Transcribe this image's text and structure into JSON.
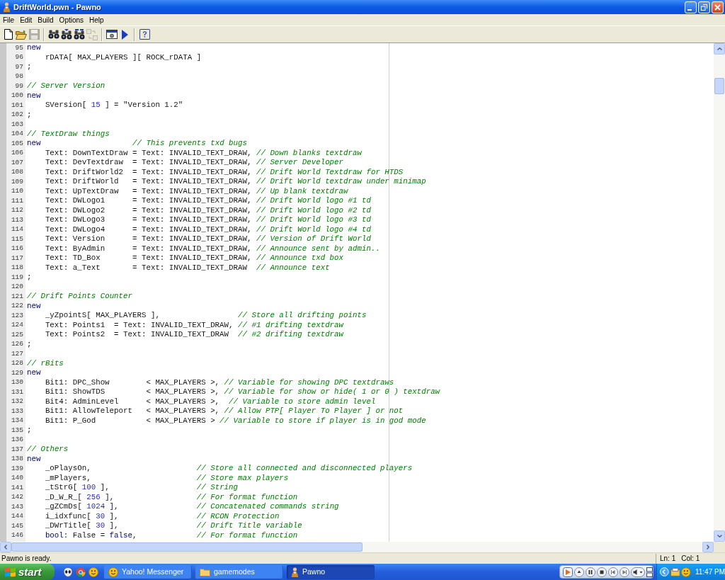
{
  "window": {
    "title": "DriftWorld.pwn - Pawno"
  },
  "menu": [
    "File",
    "Edit",
    "Build",
    "Options",
    "Help"
  ],
  "toolbar_groups": [
    [
      {
        "kind": "new",
        "disabled": false
      },
      {
        "kind": "open",
        "disabled": false
      },
      {
        "kind": "save",
        "disabled": true
      }
    ],
    [
      {
        "kind": "find",
        "disabled": false
      },
      {
        "kind": "find_next",
        "disabled": false
      },
      {
        "kind": "replace",
        "disabled": false
      },
      {
        "kind": "swap",
        "disabled": true
      }
    ],
    [
      {
        "kind": "compile",
        "disabled": false
      },
      {
        "kind": "run",
        "disabled": false
      }
    ],
    [
      {
        "kind": "help",
        "disabled": false
      }
    ]
  ],
  "editor": {
    "lines": [
      {
        "number": "95",
        "segments": [
          {
            "kind": "keyword",
            "text": "new"
          }
        ],
        "children": [
          {
            "number": "96",
            "segments": [
              {
                "kind": "plain",
                "text": "rDATA[ MAX_PLAYERS ][ ROCK_rDATA ]"
              }
            ]
          }
        ]
      },
      {
        "number": "97",
        "segments": [
          {
            "kind": "plain",
            "text": ";"
          }
        ]
      },
      {
        "number": "98"
      },
      {
        "number": "99",
        "segments": [
          {
            "kind": "comment",
            "text": "// Server Version"
          }
        ]
      },
      {
        "number": "100",
        "segments": [
          {
            "kind": "keyword",
            "text": "new"
          }
        ],
        "children": [
          {
            "number": "101",
            "segments": [
              {
                "kind": "plain",
                "text": "SVersion[ "
              },
              {
                "kind": "number",
                "text": "15"
              },
              {
                "kind": "plain",
                "text": " ] = \"Version 1.2\""
              }
            ]
          }
        ]
      },
      {
        "number": "102",
        "segments": [
          {
            "kind": "plain",
            "text": ";"
          }
        ]
      },
      {
        "number": "103"
      },
      {
        "number": "104",
        "segments": [
          {
            "kind": "comment",
            "text": "// TextDraw things"
          }
        ]
      },
      {
        "number": "105",
        "segments": [
          {
            "kind": "keyword",
            "text": "new"
          },
          {
            "kind": "comment",
            "text": "                    // This prevents txd bugs"
          }
        ],
        "children": [
          {
            "number": "106",
            "segments": [
              {
                "kind": "plain",
                "text": "Text: DownTextDraw = Text: INVALID_TEXT_DRAW, "
              },
              {
                "kind": "comment",
                "text": "// Down blanks textdraw"
              }
            ]
          },
          {
            "number": "107",
            "segments": [
              {
                "kind": "plain",
                "text": "Text: DevTextdraw  = Text: INVALID_TEXT_DRAW, "
              },
              {
                "kind": "comment",
                "text": "// Server Developer"
              }
            ]
          },
          {
            "number": "108",
            "segments": [
              {
                "kind": "plain",
                "text": "Text: DriftWorld2  = Text: INVALID_TEXT_DRAW, "
              },
              {
                "kind": "comment",
                "text": "// Drift World Textdraw for HTDS"
              }
            ]
          },
          {
            "number": "109",
            "segments": [
              {
                "kind": "plain",
                "text": "Text: DriftWorld   = Text: INVALID_TEXT_DRAW, "
              },
              {
                "kind": "comment",
                "text": "// Drift World textdraw under minimap"
              }
            ]
          },
          {
            "number": "110",
            "segments": [
              {
                "kind": "plain",
                "text": "Text: UpTextDraw   = Text: INVALID_TEXT_DRAW, "
              },
              {
                "kind": "comment",
                "text": "// Up blank textdraw"
              }
            ]
          },
          {
            "number": "111",
            "segments": [
              {
                "kind": "plain",
                "text": "Text: DWLogo1      = Text: INVALID_TEXT_DRAW, "
              },
              {
                "kind": "comment",
                "text": "// Drift World logo #1 td"
              }
            ]
          },
          {
            "number": "112",
            "segments": [
              {
                "kind": "plain",
                "text": "Text: DWLogo2      = Text: INVALID_TEXT_DRAW, "
              },
              {
                "kind": "comment",
                "text": "// Drift World logo #2 td"
              }
            ]
          },
          {
            "number": "113",
            "segments": [
              {
                "kind": "plain",
                "text": "Text: DWLogo3      = Text: INVALID_TEXT_DRAW, "
              },
              {
                "kind": "comment",
                "text": "// Drift World logo #3 td"
              }
            ]
          },
          {
            "number": "114",
            "segments": [
              {
                "kind": "plain",
                "text": "Text: DWLogo4      = Text: INVALID_TEXT_DRAW, "
              },
              {
                "kind": "comment",
                "text": "// Drift World logo #4 td"
              }
            ]
          },
          {
            "number": "115",
            "segments": [
              {
                "kind": "plain",
                "text": "Text: Version      = Text: INVALID_TEXT_DRAW, "
              },
              {
                "kind": "comment",
                "text": "// Version of Drift World"
              }
            ]
          },
          {
            "number": "116",
            "segments": [
              {
                "kind": "plain",
                "text": "Text: ByAdmin      = Text: INVALID_TEXT_DRAW, "
              },
              {
                "kind": "comment",
                "text": "// Announce sent by admin.."
              }
            ]
          },
          {
            "number": "117",
            "segments": [
              {
                "kind": "plain",
                "text": "Text: TD_Box       = Text: INVALID_TEXT_DRAW, "
              },
              {
                "kind": "comment",
                "text": "// Announce txd box"
              }
            ]
          },
          {
            "number": "118",
            "segments": [
              {
                "kind": "plain",
                "text": "Text: a_Text       = Text: INVALID_TEXT_DRAW  "
              },
              {
                "kind": "comment",
                "text": "// Announce text"
              }
            ]
          }
        ]
      },
      {
        "number": "119",
        "segments": [
          {
            "kind": "plain",
            "text": ";"
          }
        ]
      },
      {
        "number": "120"
      },
      {
        "number": "121",
        "segments": [
          {
            "kind": "comment",
            "text": "// Drift Points Counter"
          }
        ]
      },
      {
        "number": "122",
        "segments": [
          {
            "kind": "keyword",
            "text": "new"
          }
        ],
        "children": [
          {
            "number": "123",
            "segments": [
              {
                "kind": "plain",
                "text": "_yZpointS[ MAX_PLAYERS ],                 "
              },
              {
                "kind": "comment",
                "text": "// Store all drifting points"
              }
            ]
          },
          {
            "number": "124",
            "segments": [
              {
                "kind": "plain",
                "text": "Text: Points1  = Text: INVALID_TEXT_DRAW, "
              },
              {
                "kind": "comment",
                "text": "// #1 drifting textdraw"
              }
            ]
          },
          {
            "number": "125",
            "segments": [
              {
                "kind": "plain",
                "text": "Text: Points2  = Text: INVALID_TEXT_DRAW  "
              },
              {
                "kind": "comment",
                "text": "// #2 drifting textdraw"
              }
            ]
          }
        ]
      },
      {
        "number": "126",
        "segments": [
          {
            "kind": "plain",
            "text": ";"
          }
        ]
      },
      {
        "number": "127"
      },
      {
        "number": "128",
        "segments": [
          {
            "kind": "comment",
            "text": "// rBits"
          }
        ]
      },
      {
        "number": "129",
        "segments": [
          {
            "kind": "keyword",
            "text": "new"
          }
        ],
        "children": [
          {
            "number": "130",
            "segments": [
              {
                "kind": "plain",
                "text": "Bit1: DPC_Show        < MAX_PLAYERS >, "
              },
              {
                "kind": "comment",
                "text": "// Variable for showing DPC textdraws"
              }
            ]
          },
          {
            "number": "131",
            "segments": [
              {
                "kind": "plain",
                "text": "Bit1: ShowTDS         < MAX_PLAYERS >, "
              },
              {
                "kind": "comment",
                "text": "// Variable for show or hide( 1 or 0 ) textdraw"
              }
            ]
          },
          {
            "number": "132",
            "segments": [
              {
                "kind": "plain",
                "text": "Bit4: AdminLevel      < MAX_PLAYERS >,  "
              },
              {
                "kind": "comment",
                "text": "// Variable to store admin level"
              }
            ]
          },
          {
            "number": "133",
            "segments": [
              {
                "kind": "plain",
                "text": "Bit1: AllowTeleport   < MAX_PLAYERS >, "
              },
              {
                "kind": "comment",
                "text": "// Allow PTP[ Player To Player ] or not"
              }
            ]
          },
          {
            "number": "134",
            "segments": [
              {
                "kind": "plain",
                "text": "Bit1: P_God           < MAX_PLAYERS > "
              },
              {
                "kind": "comment",
                "text": "// Variable to store if player is in god mode"
              }
            ]
          }
        ]
      },
      {
        "number": "135",
        "segments": [
          {
            "kind": "plain",
            "text": ";"
          }
        ]
      },
      {
        "number": "136"
      },
      {
        "number": "137",
        "segments": [
          {
            "kind": "comment",
            "text": "// Others"
          }
        ]
      },
      {
        "number": "138",
        "segments": [
          {
            "kind": "keyword",
            "text": "new"
          }
        ],
        "children": [
          {
            "number": "139",
            "segments": [
              {
                "kind": "plain",
                "text": "_oPlaysOn,                       "
              },
              {
                "kind": "comment",
                "text": "// Store all connected and disconnected players"
              }
            ]
          },
          {
            "number": "140",
            "segments": [
              {
                "kind": "plain",
                "text": "_mPlayers,                       "
              },
              {
                "kind": "comment",
                "text": "// Store max players"
              }
            ]
          },
          {
            "number": "141",
            "segments": [
              {
                "kind": "plain",
                "text": "_tStrG[ "
              },
              {
                "kind": "number",
                "text": "100"
              },
              {
                "kind": "plain",
                "text": " ],                   "
              },
              {
                "kind": "comment",
                "text": "// String"
              }
            ]
          },
          {
            "number": "142",
            "segments": [
              {
                "kind": "plain",
                "text": "_D_W_R_[ "
              },
              {
                "kind": "number",
                "text": "256"
              },
              {
                "kind": "plain",
                "text": " ],                  "
              },
              {
                "kind": "comment",
                "text": "// For format function"
              }
            ]
          },
          {
            "number": "143",
            "segments": [
              {
                "kind": "plain",
                "text": "_gZCmDs[ "
              },
              {
                "kind": "number",
                "text": "1024"
              },
              {
                "kind": "plain",
                "text": " ],                 "
              },
              {
                "kind": "comment",
                "text": "// Concatenated commands string"
              }
            ]
          },
          {
            "number": "144",
            "segments": [
              {
                "kind": "plain",
                "text": "i_idxfunc[ "
              },
              {
                "kind": "number",
                "text": "30"
              },
              {
                "kind": "plain",
                "text": " ],                 "
              },
              {
                "kind": "comment",
                "text": "// RCON Protection"
              }
            ]
          },
          {
            "number": "145",
            "segments": [
              {
                "kind": "plain",
                "text": "_DWrTitle[ "
              },
              {
                "kind": "number",
                "text": "30"
              },
              {
                "kind": "plain",
                "text": " ],                 "
              },
              {
                "kind": "comment",
                "text": "// Drift Title variable"
              }
            ]
          },
          {
            "number": "146",
            "segments": [
              {
                "kind": "keyword",
                "text": "bool"
              },
              {
                "kind": "plain",
                "text": ": False = "
              },
              {
                "kind": "keyword",
                "text": "false"
              },
              {
                "kind": "plain",
                "text": ",             "
              },
              {
                "kind": "comment",
                "text": "// For format function"
              }
            ]
          }
        ]
      }
    ]
  },
  "status_bar": {
    "message": "Pawno is ready.",
    "line": "Ln: 1",
    "column": "Col: 1"
  },
  "taskbar": {
    "start": "start",
    "tasks": [
      {
        "kind": "messenger",
        "label": "Yahoo! Messenger",
        "selected": false
      },
      {
        "kind": "folder",
        "label": "gamemodes",
        "selected": false
      },
      {
        "kind": "app",
        "label": "Pawno",
        "selected": true
      }
    ],
    "clock": "11:47 PM"
  }
}
